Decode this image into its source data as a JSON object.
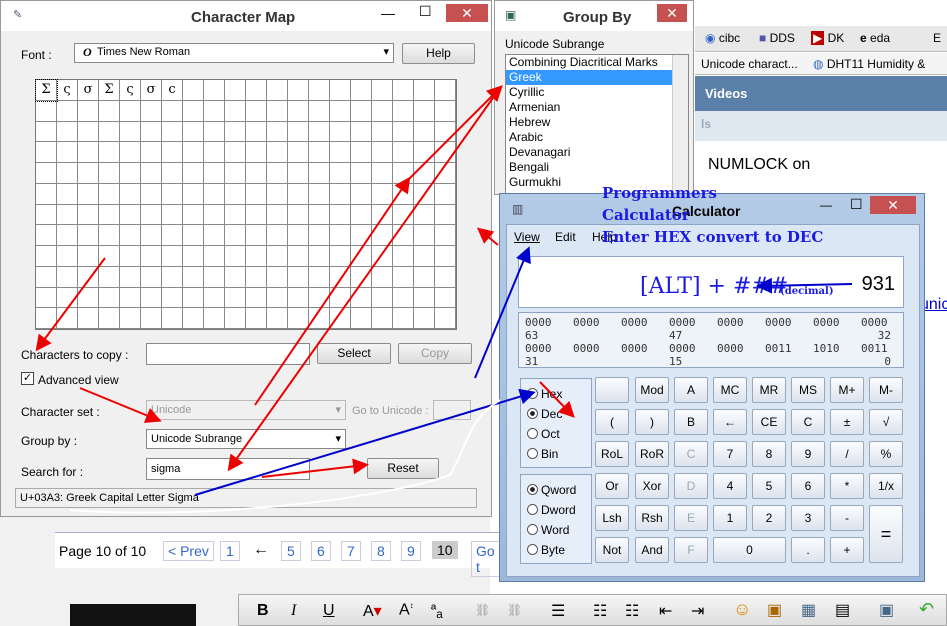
{
  "background": {
    "tabs": [
      "cibc",
      "DDS",
      "DK",
      "eda",
      "E"
    ],
    "tab2": [
      "Unicode charact...",
      "DHT11 Humidity &"
    ],
    "nav_item": "Videos",
    "nav_partial": "ls",
    "body_text": "NUMLOCK on",
    "link_partial": "unic",
    "pagination": {
      "label": "Page 10 of 10",
      "prev": "< Prev",
      "pages": [
        "1",
        "←",
        "5",
        "6",
        "7",
        "8",
        "9",
        "10"
      ],
      "goto": "Go t"
    },
    "toolbar_icons": [
      "bold",
      "italic",
      "underline",
      "font-color",
      "font-size",
      "special-char",
      "link",
      "unlink",
      "align",
      "bullets",
      "numbering",
      "outdent",
      "indent",
      "emoji",
      "media",
      "table",
      "template",
      "save",
      "undo"
    ]
  },
  "charmap": {
    "title": "Character Map",
    "font_label": "Font :",
    "font_value": "Times New Roman",
    "help": "Help",
    "chars": [
      "Σ",
      "ς",
      "σ",
      "Σ",
      "ς",
      "σ",
      "c"
    ],
    "chars_to_copy": "Characters to copy :",
    "select": "Select",
    "copy": "Copy",
    "advanced": "Advanced view",
    "charset_label": "Character set :",
    "charset_value": "Unicode",
    "goto_label": "Go to Unicode :",
    "groupby_label": "Group by :",
    "groupby_value": "Unicode Subrange",
    "search_label": "Search for :",
    "search_value": "sigma",
    "search_btn": "Reset",
    "status": "U+03A3: Greek Capital Letter Sigma"
  },
  "groupby": {
    "title": "Group By",
    "subtitle": "Unicode Subrange",
    "items": [
      "Combining Diacritical Marks",
      "Greek",
      "Cyrillic",
      "Armenian",
      "Hebrew",
      "Arabic",
      "Devanagari",
      "Bengali",
      "Gurmukhi"
    ],
    "selected": 1
  },
  "calculator": {
    "title": "Calculator",
    "menu": [
      "View",
      "Edit",
      "Help"
    ],
    "display": "931",
    "bits": [
      [
        "0000",
        "0000",
        "0000",
        "0000",
        "0000",
        "0000",
        "0000",
        "0000"
      ],
      [
        "63",
        "",
        "",
        "47",
        "",
        "",
        "",
        "32"
      ],
      [
        "0000",
        "0000",
        "0000",
        "0000",
        "0000",
        "0011",
        "1010",
        "0011"
      ],
      [
        "31",
        "",
        "",
        "15",
        "",
        "",
        "",
        "0"
      ]
    ],
    "bases": [
      "Hex",
      "Dec",
      "Oct",
      "Bin"
    ],
    "base_selected": "Dec",
    "words": [
      "Qword",
      "Dword",
      "Word",
      "Byte"
    ],
    "word_selected": "Qword",
    "keys": [
      [
        "",
        "Mod",
        "A",
        "MC",
        "MR",
        "MS",
        "M+",
        "M-"
      ],
      [
        "(",
        ")",
        "B",
        "←",
        "CE",
        "C",
        "±",
        "√"
      ],
      [
        "RoL",
        "RoR",
        "C",
        "7",
        "8",
        "9",
        "/",
        "%"
      ],
      [
        "Or",
        "Xor",
        "D",
        "4",
        "5",
        "6",
        "*",
        "1/x"
      ],
      [
        "Lsh",
        "Rsh",
        "E",
        "1",
        "2",
        "3",
        "-",
        "="
      ],
      [
        "Not",
        "And",
        "F",
        "0",
        ".",
        "+"
      ]
    ]
  },
  "annotations": {
    "title1": "Programmers",
    "title2": "Calculator",
    "hex_note": "Enter HEX convert to DEC",
    "alt_note": "[ALT] + ###",
    "decimal_note": "(decimal)"
  }
}
